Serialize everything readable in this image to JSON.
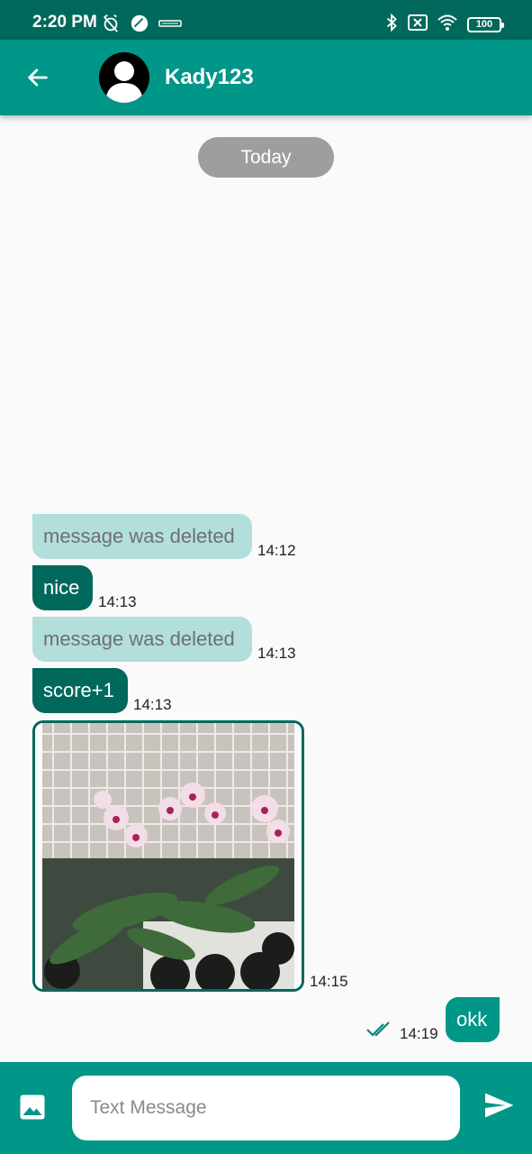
{
  "status_bar": {
    "time": "2:20 PM",
    "battery": "100",
    "left_icons": [
      "alarm-off-icon",
      "data-saver-icon",
      "network-logo-icon"
    ],
    "right_icons": [
      "bluetooth-icon",
      "sim-off-icon",
      "wifi-icon",
      "battery-icon"
    ]
  },
  "header": {
    "contact_name": "Kady123",
    "back_icon": "arrow-left-icon",
    "avatar_icon": "person-icon"
  },
  "conversation": {
    "date_label": "Today",
    "messages": [
      {
        "type": "deleted",
        "text": "message was deleted",
        "time": "14:12"
      },
      {
        "type": "text",
        "text": "nice",
        "time": "14:13"
      },
      {
        "type": "deleted",
        "text": "message was deleted",
        "time": "14:13"
      },
      {
        "type": "text",
        "text": "score+1",
        "time": "14:13"
      },
      {
        "type": "image",
        "time": "14:15"
      },
      {
        "type": "outgoing",
        "text": "okk",
        "time": "14:19",
        "status": "double-check-read-icon"
      }
    ]
  },
  "composer": {
    "placeholder": "Text Message",
    "value": "",
    "gallery_icon": "image-icon",
    "send_icon": "send-icon"
  },
  "colors": {
    "status_bar": "#00695c",
    "primary": "#009688",
    "dark_bubble": "#00695c",
    "deleted_bubble": "#b2dfdb",
    "date_chip": "#9e9e9e"
  }
}
